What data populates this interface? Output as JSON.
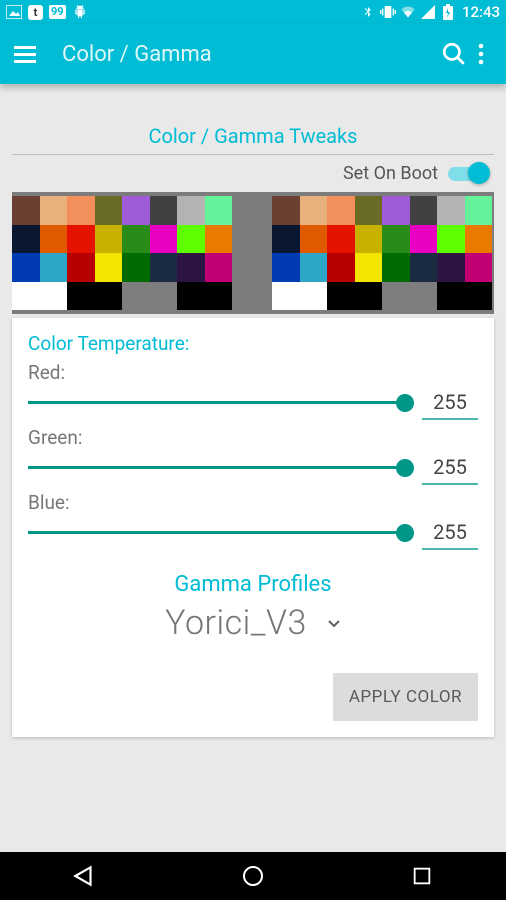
{
  "statusbar": {
    "time": "12:43"
  },
  "appbar": {
    "title": "Color / Gamma"
  },
  "section": {
    "title": "Color / Gamma Tweaks"
  },
  "boot": {
    "label": "Set On Boot",
    "on": true
  },
  "colorTemp": {
    "header": "Color Temperature:",
    "red": {
      "label": "Red:",
      "value": "255"
    },
    "green": {
      "label": "Green:",
      "value": "255"
    },
    "blue": {
      "label": "Blue:",
      "value": "255"
    }
  },
  "profiles": {
    "title": "Gamma Profiles",
    "selected": "Yorici_V3"
  },
  "buttons": {
    "apply": "APPLY COLOR"
  },
  "swatches": [
    "#6b4032",
    "#e8b07a",
    "#f28f5a",
    "#6a6c25",
    "#a05cd6",
    "#414141",
    "#b3b3b3",
    "#66f29a",
    "#0a1730",
    "#e05a00",
    "#e61200",
    "#c8b200",
    "#2a8c18",
    "#e800c3",
    "#5eff00",
    "#e87a00",
    "#003bb3",
    "#2da6c7",
    "#b80000",
    "#f2e600",
    "#006b00",
    "#1b2b42",
    "#2c1542",
    "#c20073",
    "#ffffff",
    "#ffffff",
    "#000000",
    "#000000",
    "#7e7e7e",
    "#7e7e7e",
    "#000000",
    "#000000"
  ]
}
